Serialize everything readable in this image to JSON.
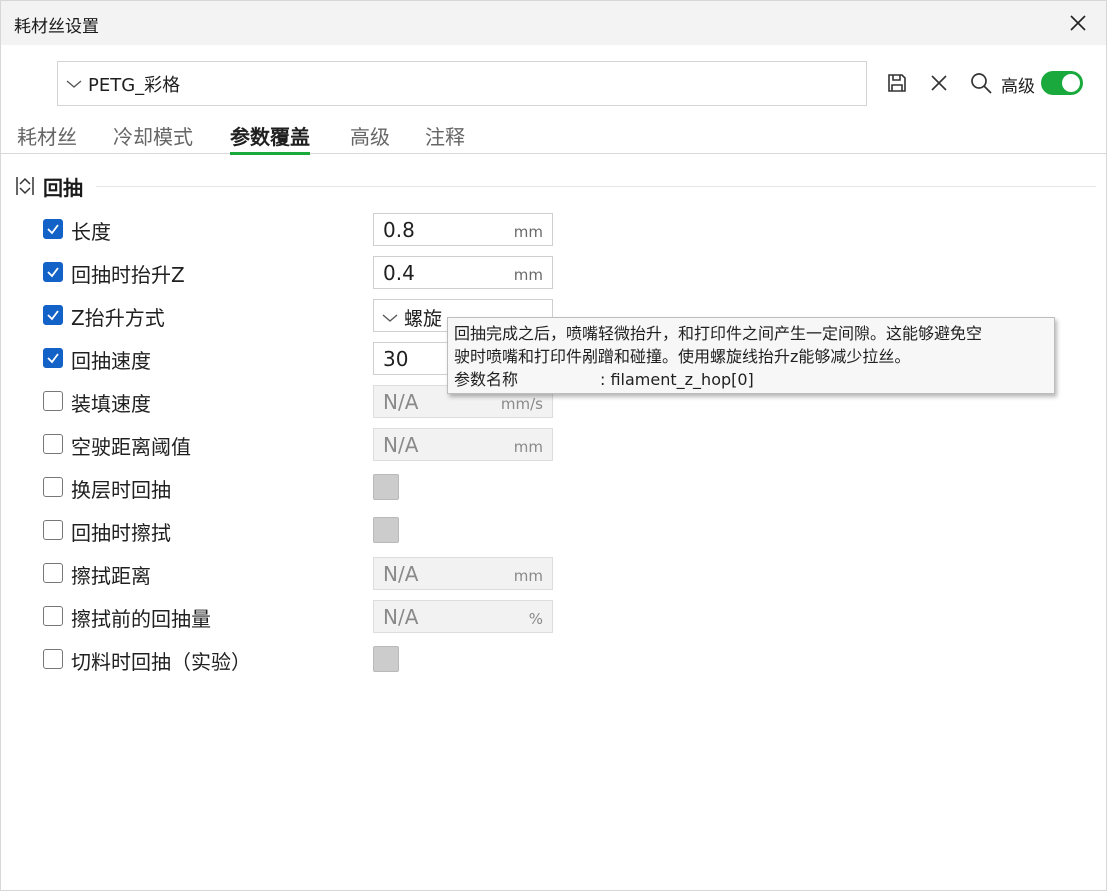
{
  "window": {
    "title": "耗材丝设置"
  },
  "preset": {
    "name": "PETG_彩格"
  },
  "toolbar": {
    "advanced_label": "高级",
    "advanced_on": true
  },
  "tabs": [
    {
      "label": "耗材丝",
      "active": false
    },
    {
      "label": "冷却模式",
      "active": false
    },
    {
      "label": "参数覆盖",
      "active": true
    },
    {
      "label": "高级",
      "active": false
    },
    {
      "label": "注释",
      "active": false
    }
  ],
  "section": {
    "title": "回抽"
  },
  "rows": [
    {
      "label": "长度",
      "checked": true,
      "type": "input",
      "value": "0.8",
      "unit": "mm"
    },
    {
      "label": "回抽时抬升Z",
      "checked": true,
      "type": "input",
      "value": "0.4",
      "unit": "mm"
    },
    {
      "label": "Z抬升方式",
      "checked": true,
      "type": "combo",
      "value": "螺旋"
    },
    {
      "label": "回抽速度",
      "checked": true,
      "type": "input",
      "value": "30",
      "unit": ""
    },
    {
      "label": "装填速度",
      "checked": false,
      "type": "input",
      "value": "N/A",
      "unit": "mm/s"
    },
    {
      "label": "空驶距离阈值",
      "checked": false,
      "type": "input",
      "value": "N/A",
      "unit": "mm"
    },
    {
      "label": "换层时回抽",
      "checked": false,
      "type": "checkbox"
    },
    {
      "label": "回抽时擦拭",
      "checked": false,
      "type": "checkbox"
    },
    {
      "label": "擦拭距离",
      "checked": false,
      "type": "input",
      "value": "N/A",
      "unit": "mm"
    },
    {
      "label": "擦拭前的回抽量",
      "checked": false,
      "type": "input",
      "value": "N/A",
      "unit": "%"
    },
    {
      "label": "切料时回抽（实验）",
      "checked": false,
      "type": "checkbox"
    }
  ],
  "tooltip": {
    "line1": "回抽完成之后，喷嘴轻微抬升，和打印件之间产生一定间隙。这能够避免空",
    "line2": "驶时喷嘴和打印件剐蹭和碰撞。使用螺旋线抬升z能够减少拉丝。",
    "param_key": "参数名称",
    "param_value": ": filament_z_hop[0]"
  },
  "colors": {
    "accent": "#1aa93d",
    "checkbox": "#1262c7"
  }
}
